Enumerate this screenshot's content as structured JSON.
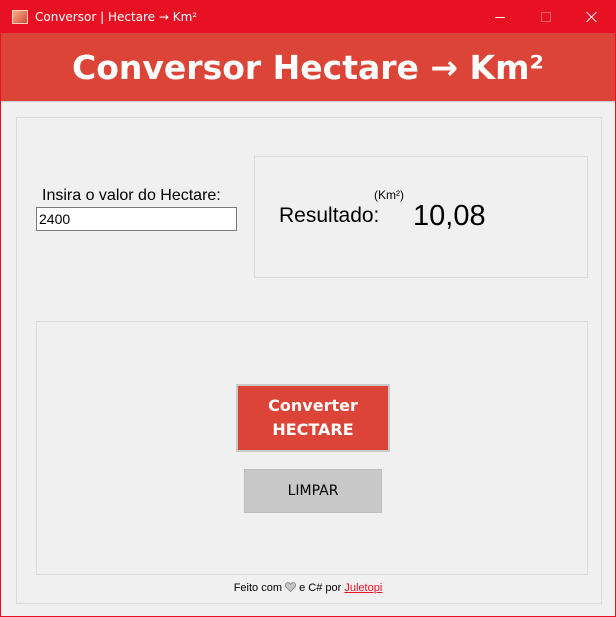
{
  "window": {
    "title": "Conversor | Hectare → Km²",
    "close_color": "#e81123"
  },
  "header": {
    "title": "Conversor Hectare → Km²",
    "color": "#db4437"
  },
  "input": {
    "label": "Insira o valor do Hectare:",
    "value": "2400"
  },
  "result": {
    "unit": "(Km²)",
    "label": "Resultado:",
    "value": "10,08"
  },
  "buttons": {
    "convert_line1": "Converter",
    "convert_line2": "HECTARE",
    "clear": "LIMPAR"
  },
  "footer": {
    "text_before": "Feito com",
    "heart_icon": "heart-icon",
    "text_middle": "e C# por",
    "author": "Juletopi"
  }
}
